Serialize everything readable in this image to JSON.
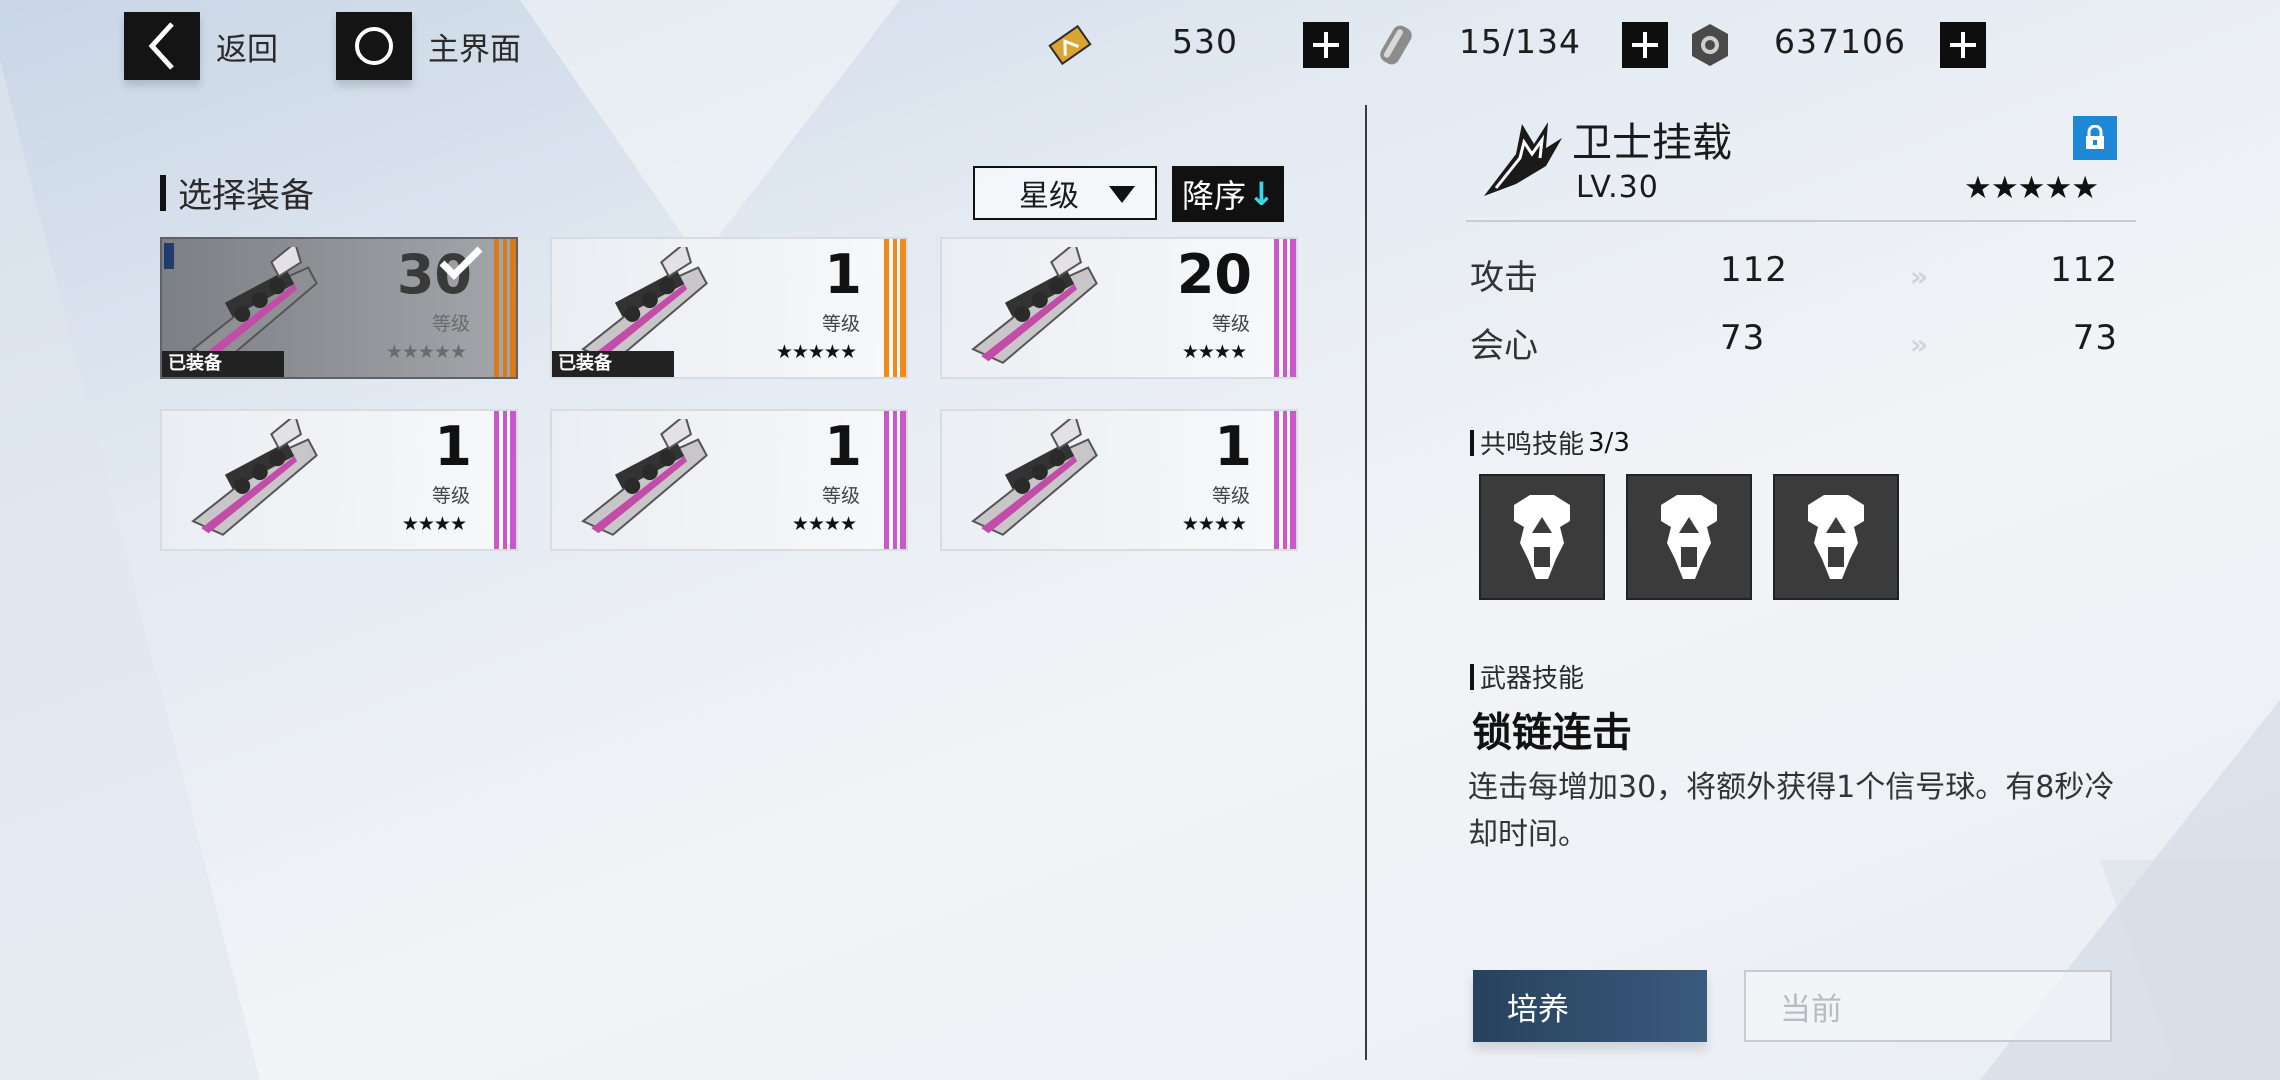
{
  "topbar": {
    "back_label": "返回",
    "home_label": "主界面",
    "resources": [
      {
        "icon": "ticket-icon",
        "value": "530"
      },
      {
        "icon": "battery-icon",
        "value": "15/134"
      },
      {
        "icon": "gear-coin-icon",
        "value": "637106"
      }
    ]
  },
  "left": {
    "title": "选择装备",
    "sort_label": "星级",
    "order_label": "降序",
    "order_arrow": "↓",
    "equipped_badge": "已装备",
    "level_caption": "等级",
    "cards": [
      {
        "level": "30",
        "stars": "★★★★★",
        "equipped": true,
        "selected": true,
        "rarity_color": "#d97a1c"
      },
      {
        "level": "1",
        "stars": "★★★★★",
        "equipped": true,
        "selected": false,
        "rarity_color": "#f08a1c"
      },
      {
        "level": "20",
        "stars": "★★★★",
        "equipped": false,
        "selected": false,
        "rarity_color": "#c85ac8"
      },
      {
        "level": "1",
        "stars": "★★★★",
        "equipped": false,
        "selected": false,
        "rarity_color": "#c85ac8"
      },
      {
        "level": "1",
        "stars": "★★★★",
        "equipped": false,
        "selected": false,
        "rarity_color": "#c85ac8"
      },
      {
        "level": "1",
        "stars": "★★★★",
        "equipped": false,
        "selected": false,
        "rarity_color": "#c85ac8"
      }
    ]
  },
  "right": {
    "name": "卫士挂载",
    "level": "LV.30",
    "stars": "★★★★★",
    "stats": [
      {
        "name": "攻击",
        "current": "112",
        "next": "112"
      },
      {
        "name": "会心",
        "current": "73",
        "next": "73"
      }
    ],
    "resonance_label": "共鸣技能",
    "resonance_count": "3/3",
    "weapon_skill_label": "武器技能",
    "skill_name": "锁链连击",
    "skill_desc": "连击每增加30，将额外获得1个信号球。有8秒冷却时间。",
    "train_button": "培养",
    "current_button": "当前"
  }
}
